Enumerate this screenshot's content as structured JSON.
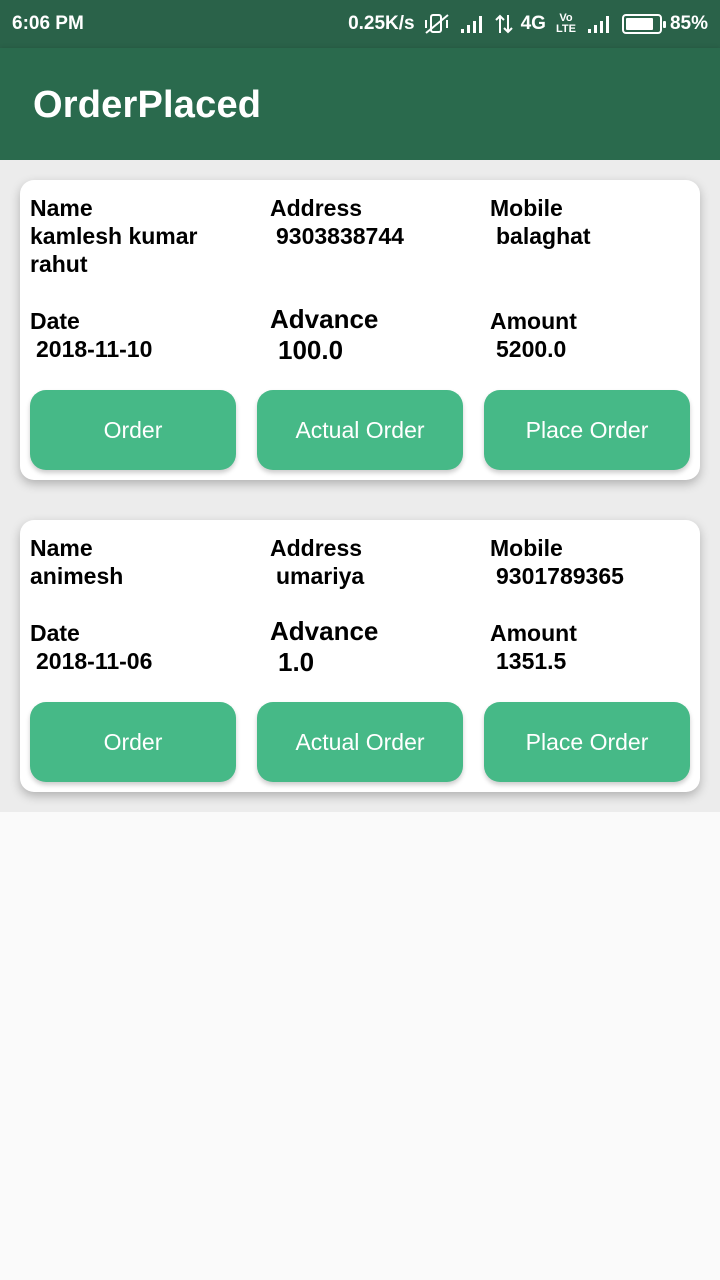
{
  "status": {
    "time": "6:06 PM",
    "speed": "0.25K/s",
    "network": "4G",
    "lte": "Vo LTE",
    "battery": "85%",
    "battery_level": 0.85
  },
  "app": {
    "title": "OrderPlaced"
  },
  "labels": {
    "name": "Name",
    "address": "Address",
    "mobile": "Mobile",
    "date": "Date",
    "advance": "Advance",
    "amount": "Amount",
    "order_btn": "Order",
    "actual_btn": "Actual Order",
    "place_btn": "Place Order"
  },
  "orders": [
    {
      "name": "kamlesh kumar rahut",
      "address": "9303838744",
      "mobile": "balaghat",
      "date": "2018-11-10",
      "advance": "100.0",
      "amount": "5200.0"
    },
    {
      "name": "animesh",
      "address": "umariya",
      "mobile": "9301789365",
      "date": "2018-11-06",
      "advance": "1.0",
      "amount": "1351.5"
    }
  ],
  "colors": {
    "status_bar": "#2a6249",
    "app_bar": "#2a6a4d",
    "button": "#46b987"
  }
}
